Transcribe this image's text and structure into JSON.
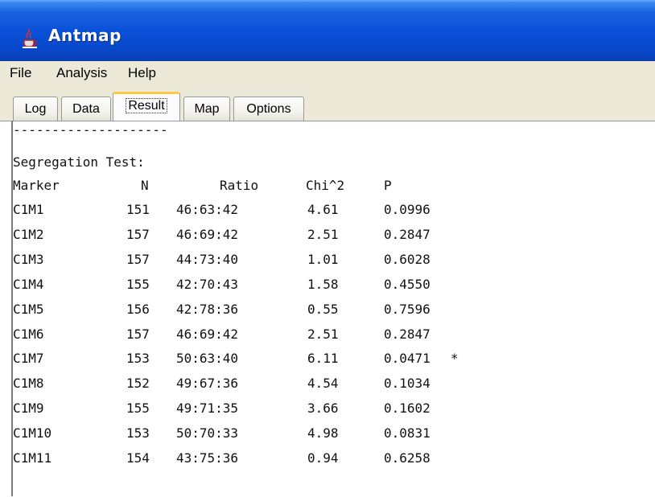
{
  "window": {
    "title": "Antmap"
  },
  "menu": {
    "items": [
      "File",
      "Analysis",
      "Help"
    ]
  },
  "tabs": [
    "Log",
    "Data",
    "Result",
    "Map",
    "Options"
  ],
  "active_tab": "Result",
  "content": {
    "separator": "--------------------",
    "heading": "Segregation Test:",
    "columns": [
      "Marker",
      "N",
      "Ratio",
      "Chi^2",
      "P"
    ],
    "rows": [
      {
        "marker": "C1M1",
        "n": "151",
        "ratio": "46:63:42",
        "chi2": "4.61",
        "p": "0.0996",
        "flag": ""
      },
      {
        "marker": "C1M2",
        "n": "157",
        "ratio": "46:69:42",
        "chi2": "2.51",
        "p": "0.2847",
        "flag": ""
      },
      {
        "marker": "C1M3",
        "n": "157",
        "ratio": "44:73:40",
        "chi2": "1.01",
        "p": "0.6028",
        "flag": ""
      },
      {
        "marker": "C1M4",
        "n": "155",
        "ratio": "42:70:43",
        "chi2": "1.58",
        "p": "0.4550",
        "flag": ""
      },
      {
        "marker": "C1M5",
        "n": "156",
        "ratio": "42:78:36",
        "chi2": "0.55",
        "p": "0.7596",
        "flag": ""
      },
      {
        "marker": "C1M6",
        "n": "157",
        "ratio": "46:69:42",
        "chi2": "2.51",
        "p": "0.2847",
        "flag": ""
      },
      {
        "marker": "C1M7",
        "n": "153",
        "ratio": "50:63:40",
        "chi2": "6.11",
        "p": "0.0471",
        "flag": "*"
      },
      {
        "marker": "C1M8",
        "n": "152",
        "ratio": "49:67:36",
        "chi2": "4.54",
        "p": "0.1034",
        "flag": ""
      },
      {
        "marker": "C1M9",
        "n": "155",
        "ratio": "49:71:35",
        "chi2": "3.66",
        "p": "0.1602",
        "flag": ""
      },
      {
        "marker": "C1M10",
        "n": "153",
        "ratio": "50:70:33",
        "chi2": "4.98",
        "p": "0.0831",
        "flag": ""
      },
      {
        "marker": "C1M11",
        "n": "154",
        "ratio": "43:75:36",
        "chi2": "0.94",
        "p": "0.6258",
        "flag": ""
      }
    ]
  },
  "icons": {
    "app": "java-cup-icon"
  },
  "colors": {
    "titlebar": "#0a50d8",
    "menubar": "#ece9d8",
    "active_tab_accent": "#ffc83c"
  }
}
